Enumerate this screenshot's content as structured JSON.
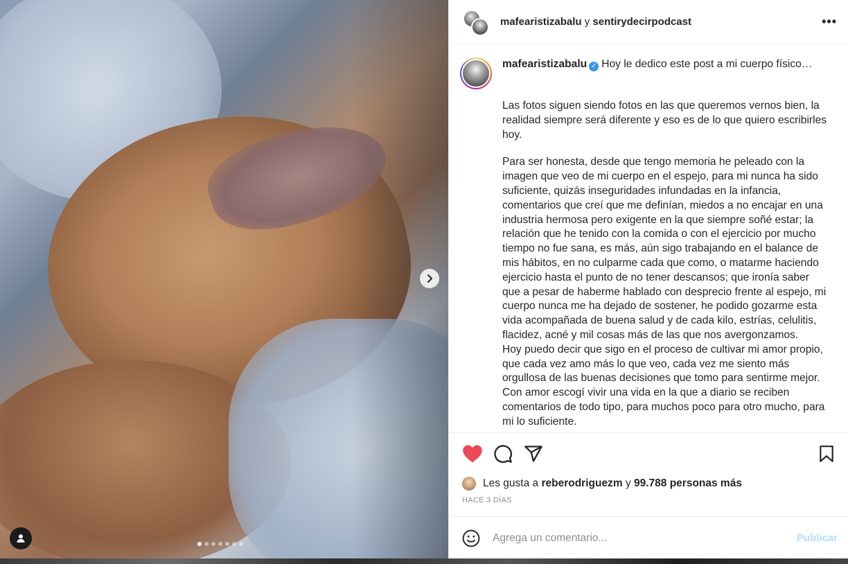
{
  "header": {
    "author1": "mafearistizabalu",
    "joiner": "y",
    "author2": "sentirydecirpodcast",
    "more_icon": "more-horizontal-icon"
  },
  "caption": {
    "username": "mafearistizabalu",
    "verified_icon": "verified-badge-icon",
    "first_line": "Hoy le dedico este post a mi cuerpo físico…",
    "para1": "Las fotos siguen siendo fotos en las que queremos vernos bien, la realidad siempre será diferente y eso es de lo que quiero escribirles hoy.",
    "para2": "Para ser honesta, desde que tengo memoria he peleado con la imagen que veo de mi cuerpo en el espejo, para mi nunca ha sido suficiente, quizás inseguridades infundadas en la infancia, comentarios que creí que me definían, miedos a no encajar en una industria hermosa pero exigente en la que siempre soñé estar; la relación que he tenido con la comida o con el ejercicio por mucho tiempo no fue sana, es más, aún sigo trabajando en el balance de mis hábitos, en no culparme cada que como, o matarme haciendo ejercicio hasta el punto de no tener descansos; que ironía saber que a pesar de haberme hablado con desprecio frente al espejo, mi cuerpo nunca me ha dejado de sostener, he podido gozarme esta vida acompañada de buena salud y de cada kilo, estrías, celulitis, flacidez, acné y mil cosas más de las que nos avergonzamos.\nHoy puedo decir que sigo en el proceso de cultivar mi amor propio, que cada vez amo más lo que veo, cada vez me siento más orgullosa de las buenas decisiones que tomo para sentirme mejor. Con amor escogí vivir una vida en la que a diario se reciben comentarios de todo tipo, para muchos poco para otro mucho, para mi lo suficiente."
  },
  "actions": {
    "like_icon": "heart-filled-icon",
    "comment_icon": "comment-icon",
    "share_icon": "share-icon",
    "save_icon": "bookmark-icon",
    "like_color": "#ed4956"
  },
  "likes": {
    "prefix": "Les gusta a",
    "user": "reberodriguezm",
    "joiner": "y",
    "count_text": "99.788 personas más"
  },
  "time": "HACE 3 DÍAS",
  "comment": {
    "emoji_icon": "emoji-icon",
    "placeholder": "Agrega un comentario...",
    "publish_label": "Publicar",
    "publish_color": "#b2dffc"
  },
  "media": {
    "next_icon": "chevron-right-icon",
    "tag_icon": "user-tag-icon",
    "slide_count": 7,
    "active_slide": 1
  }
}
